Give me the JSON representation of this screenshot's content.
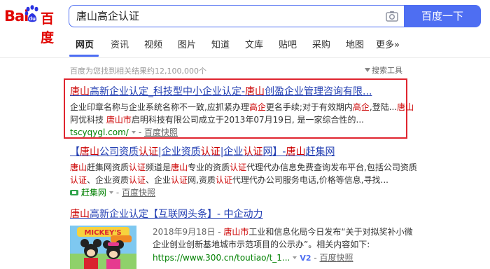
{
  "header": {
    "logo_bai": "Bai",
    "logo_du": "百度",
    "search_value": "唐山高企认证",
    "search_button": "百度一下"
  },
  "tabs": [
    {
      "label": "网页",
      "active": true
    },
    {
      "label": "资讯"
    },
    {
      "label": "视频"
    },
    {
      "label": "图片"
    },
    {
      "label": "知道"
    },
    {
      "label": "文库"
    },
    {
      "label": "贴吧"
    },
    {
      "label": "采购"
    },
    {
      "label": "地图"
    },
    {
      "label": "更多»"
    }
  ],
  "result_count": "百度为您找到相关结果约12,100,000个",
  "search_tools": "搜索工具",
  "results": [
    {
      "title": [
        "唐山",
        "高新企业认定_科技型中小企业认定-",
        "唐山",
        "创盈企业管理咨询有限..."
      ],
      "abstract_line1": [
        "企业印章名称与企业系统名称不一致,应抓紧办理",
        "高企",
        "更名手续;对于有效期内",
        "高企",
        ",登陆...",
        "唐山"
      ],
      "abstract_line2": [
        "阿优科技 ",
        "唐山市",
        "启明科技有限公司成立于2013年07月19日, 是一家综合性的..."
      ],
      "url": "tscyqygl.com/",
      "snapshot": "百度快照"
    },
    {
      "title": [
        "【",
        "唐山",
        "公司资质",
        "认证",
        "|企业资质",
        "认证",
        "|企业",
        "认证",
        "网】-",
        "唐山",
        "赶集网"
      ],
      "abstract_line1": [
        "唐山",
        "赶集网资质",
        "认证",
        "频道是",
        "唐山",
        "专业的资质",
        "认证",
        "代理代办信息免费查询发布平台,包括公司资质"
      ],
      "abstract_line2": [
        "认证",
        "、企业资质",
        "认证",
        "、企业",
        "认证",
        "网,资质",
        "认证",
        "代理代办公司服务电话,价格等信息,寻找..."
      ],
      "url": "赶集网",
      "snapshot": "百度快照"
    },
    {
      "title": [
        "唐山",
        "高新企业认定【互联网头条】- 中企动力"
      ],
      "abstract_line1": [
        "2018年9月18日 - ",
        "唐山市",
        "工业和信息化局今日发布“关于对拟奖补小微"
      ],
      "abstract_line2": [
        "企业创业创新基地城市示范项目的公示办”。相关内容如下:"
      ],
      "url": "https://www.300.cn/toutiao/t_1...",
      "v2": "V2",
      "snapshot": "百度快照"
    }
  ]
}
